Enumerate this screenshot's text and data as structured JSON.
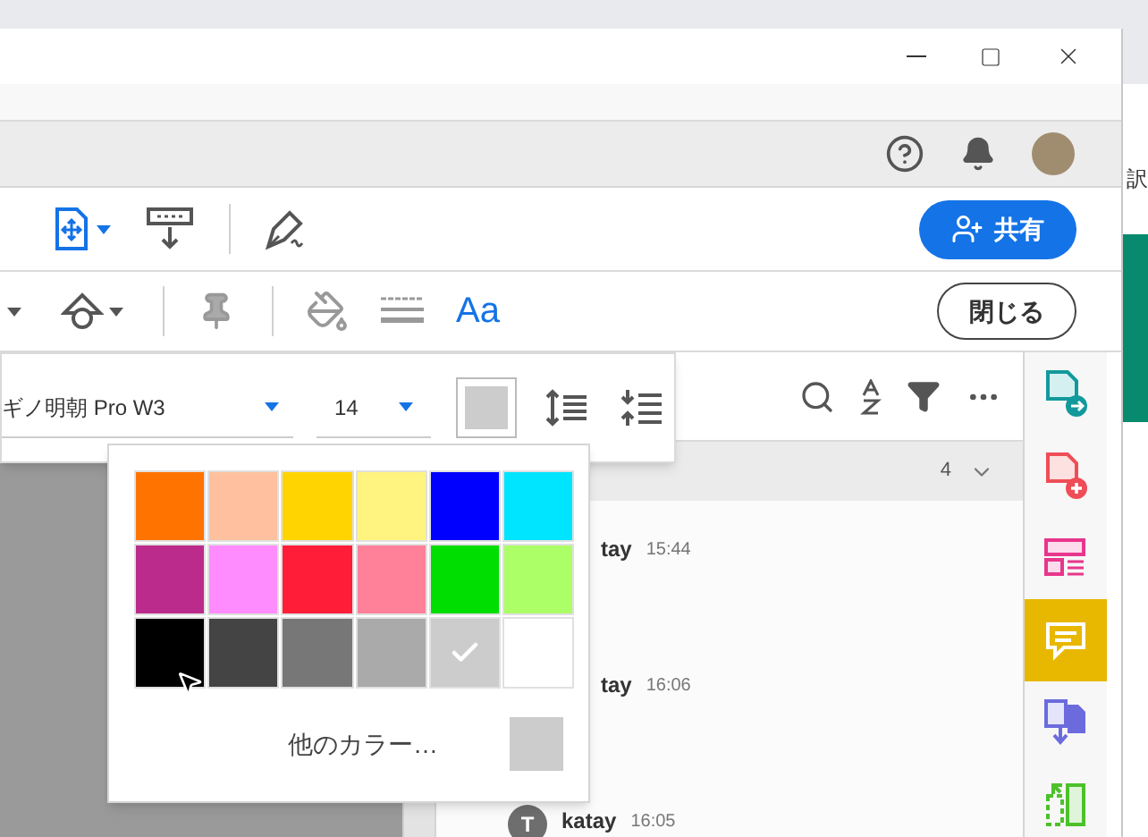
{
  "background": {
    "side_label": "訳"
  },
  "toolbar": {
    "share_button": "共有"
  },
  "tools_bar": {
    "text_tool": {
      "label": "Aa",
      "selected": true
    },
    "close_button": "閉じる"
  },
  "text_properties": {
    "font": "ギノ明朝 Pro W3",
    "size": "14"
  },
  "color_picker": {
    "swatches": [
      {
        "color": "#ff7300",
        "selected": false
      },
      {
        "color": "#ffc09f",
        "selected": false
      },
      {
        "color": "#ffd400",
        "selected": false
      },
      {
        "color": "#fff47f",
        "selected": false
      },
      {
        "color": "#0000ff",
        "selected": false
      },
      {
        "color": "#00e5ff",
        "selected": false
      },
      {
        "color": "#bb2b8b",
        "selected": false
      },
      {
        "color": "#ff8cff",
        "selected": false
      },
      {
        "color": "#ff1d37",
        "selected": false
      },
      {
        "color": "#ff8099",
        "selected": false
      },
      {
        "color": "#00dd00",
        "selected": false
      },
      {
        "color": "#acff66",
        "selected": false
      },
      {
        "color": "#000000",
        "selected": false
      },
      {
        "color": "#444444",
        "selected": false
      },
      {
        "color": "#777777",
        "selected": false
      },
      {
        "color": "#aaaaaa",
        "selected": false
      },
      {
        "color": "#cccccc",
        "selected": true
      },
      {
        "color": "#ffffff",
        "selected": false
      }
    ],
    "more_colors": "他のカラー…"
  },
  "comments_panel": {
    "page_count": "4",
    "comments": [
      {
        "author": "tay",
        "time": "15:44"
      },
      {
        "author": "tay",
        "time": "16:06"
      },
      {
        "author": "katay",
        "time": "16:05",
        "avatar": "T"
      }
    ]
  },
  "sidebar": {
    "tools": [
      {
        "selected": false
      },
      {
        "selected": false
      },
      {
        "selected": false
      },
      {
        "selected": true
      },
      {
        "selected": false
      },
      {
        "selected": false
      }
    ]
  }
}
